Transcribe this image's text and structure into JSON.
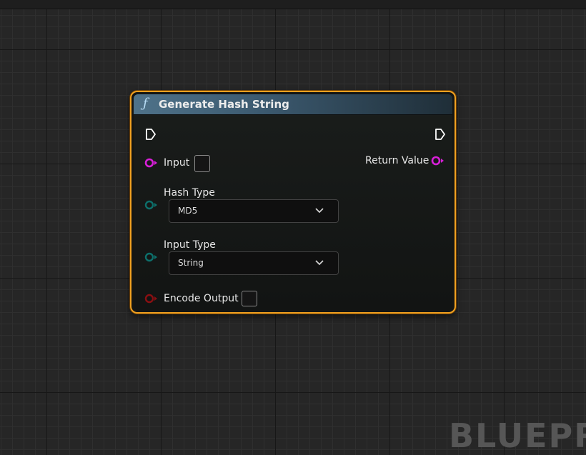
{
  "node": {
    "title": "Generate Hash String",
    "input_pins": [
      {
        "label": "Input",
        "color": "#d81fd8"
      },
      {
        "label": "Hash Type",
        "color": "#0d6f6b",
        "selected": "MD5"
      },
      {
        "label": "Input Type",
        "color": "#0d6f6b",
        "selected": "String"
      },
      {
        "label": "Encode Output",
        "color": "#8a0f12"
      }
    ],
    "output_pins": [
      {
        "label": "Return Value",
        "color": "#d81fd8"
      }
    ],
    "border_color": "#f0a020",
    "header_color": "#4f7289"
  },
  "icons": {
    "function": "function-icon",
    "exec_in": "exec-in-icon",
    "exec_out": "exec-out-icon",
    "chevron": "chevron-down-icon"
  },
  "watermark": "BLUEPR"
}
